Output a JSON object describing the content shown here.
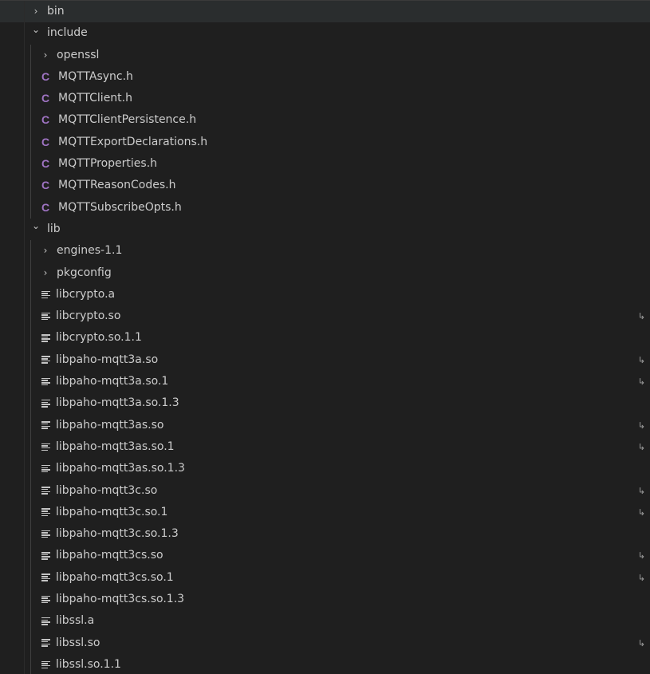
{
  "explorer": {
    "items": [
      {
        "label": "bin",
        "kind": "folder",
        "state": "collapsed",
        "depth": 0,
        "chevron": "›",
        "selected": true
      },
      {
        "label": "include",
        "kind": "folder",
        "state": "expanded",
        "depth": 0,
        "chevron": "⌄"
      },
      {
        "label": "openssl",
        "kind": "folder",
        "state": "collapsed",
        "depth": 1,
        "chevron": "›"
      },
      {
        "label": "MQTTAsync.h",
        "kind": "c-header",
        "depth": 1,
        "icon_text": "C"
      },
      {
        "label": "MQTTClient.h",
        "kind": "c-header",
        "depth": 1,
        "icon_text": "C"
      },
      {
        "label": "MQTTClientPersistence.h",
        "kind": "c-header",
        "depth": 1,
        "icon_text": "C"
      },
      {
        "label": "MQTTExportDeclarations.h",
        "kind": "c-header",
        "depth": 1,
        "icon_text": "C"
      },
      {
        "label": "MQTTProperties.h",
        "kind": "c-header",
        "depth": 1,
        "icon_text": "C"
      },
      {
        "label": "MQTTReasonCodes.h",
        "kind": "c-header",
        "depth": 1,
        "icon_text": "C"
      },
      {
        "label": "MQTTSubscribeOpts.h",
        "kind": "c-header",
        "depth": 1,
        "icon_text": "C"
      },
      {
        "label": "lib",
        "kind": "folder",
        "state": "expanded",
        "depth": 0,
        "chevron": "⌄"
      },
      {
        "label": "engines-1.1",
        "kind": "folder",
        "state": "collapsed",
        "depth": 1,
        "chevron": "›"
      },
      {
        "label": "pkgconfig",
        "kind": "folder",
        "state": "collapsed",
        "depth": 1,
        "chevron": "›"
      },
      {
        "label": "libcrypto.a",
        "kind": "file",
        "depth": 1,
        "symlink": false
      },
      {
        "label": "libcrypto.so",
        "kind": "file",
        "depth": 1,
        "symlink": true
      },
      {
        "label": "libcrypto.so.1.1",
        "kind": "file",
        "depth": 1,
        "symlink": false
      },
      {
        "label": "libpaho-mqtt3a.so",
        "kind": "file",
        "depth": 1,
        "symlink": true
      },
      {
        "label": "libpaho-mqtt3a.so.1",
        "kind": "file",
        "depth": 1,
        "symlink": true
      },
      {
        "label": "libpaho-mqtt3a.so.1.3",
        "kind": "file",
        "depth": 1,
        "symlink": false
      },
      {
        "label": "libpaho-mqtt3as.so",
        "kind": "file",
        "depth": 1,
        "symlink": true
      },
      {
        "label": "libpaho-mqtt3as.so.1",
        "kind": "file",
        "depth": 1,
        "symlink": true
      },
      {
        "label": "libpaho-mqtt3as.so.1.3",
        "kind": "file",
        "depth": 1,
        "symlink": false
      },
      {
        "label": "libpaho-mqtt3c.so",
        "kind": "file",
        "depth": 1,
        "symlink": true
      },
      {
        "label": "libpaho-mqtt3c.so.1",
        "kind": "file",
        "depth": 1,
        "symlink": true
      },
      {
        "label": "libpaho-mqtt3c.so.1.3",
        "kind": "file",
        "depth": 1,
        "symlink": false
      },
      {
        "label": "libpaho-mqtt3cs.so",
        "kind": "file",
        "depth": 1,
        "symlink": true
      },
      {
        "label": "libpaho-mqtt3cs.so.1",
        "kind": "file",
        "depth": 1,
        "symlink": true
      },
      {
        "label": "libpaho-mqtt3cs.so.1.3",
        "kind": "file",
        "depth": 1,
        "symlink": false
      },
      {
        "label": "libssl.a",
        "kind": "file",
        "depth": 1,
        "symlink": false
      },
      {
        "label": "libssl.so",
        "kind": "file",
        "depth": 1,
        "symlink": true
      },
      {
        "label": "libssl.so.1.1",
        "kind": "file",
        "depth": 1,
        "symlink": false
      }
    ],
    "symlink_glyph": "↳"
  },
  "colors": {
    "background": "#1f1f1f",
    "text": "#cccccc",
    "c_icon": "#a074c4",
    "selected_row": "#2a2d2e",
    "indent_guide": "#404040"
  }
}
